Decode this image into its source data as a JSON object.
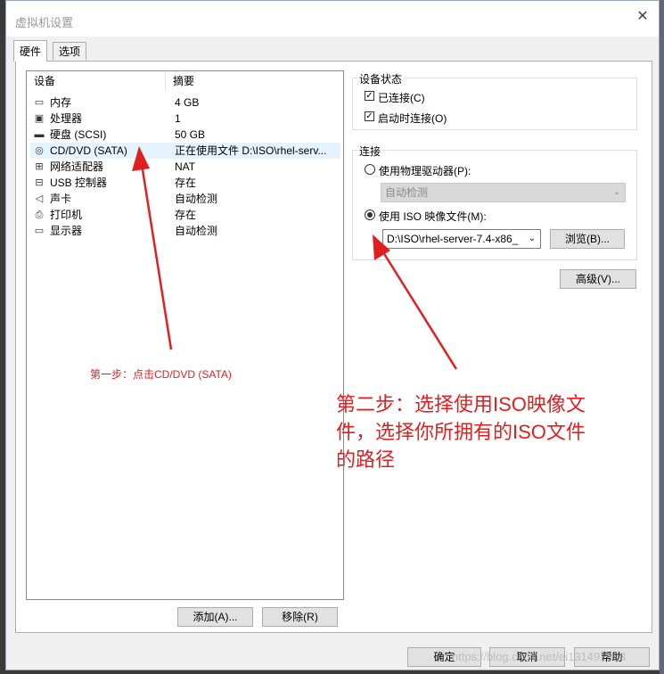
{
  "window": {
    "title": "虚拟机设置",
    "close_glyph": "✕"
  },
  "tabs": [
    {
      "label": "硬件",
      "active": true
    },
    {
      "label": "选项",
      "active": false
    }
  ],
  "device_list": {
    "headers": {
      "device": "设备",
      "summary": "摘要"
    },
    "rows": [
      {
        "icon": "memory-icon",
        "device": "内存",
        "summary": "4 GB"
      },
      {
        "icon": "processor-icon",
        "device": "处理器",
        "summary": "1"
      },
      {
        "icon": "harddisk-icon",
        "device": "硬盘 (SCSI)",
        "summary": "50 GB"
      },
      {
        "icon": "cd-dvd-icon",
        "device": "CD/DVD (SATA)",
        "summary": "正在使用文件 D:\\ISO\\rhel-serv...",
        "selected": true
      },
      {
        "icon": "network-adapter-icon",
        "device": "网络适配器",
        "summary": "NAT"
      },
      {
        "icon": "usb-icon",
        "device": "USB 控制器",
        "summary": "存在"
      },
      {
        "icon": "sound-card-icon",
        "device": "声卡",
        "summary": "自动检测"
      },
      {
        "icon": "printer-icon",
        "device": "打印机",
        "summary": "存在"
      },
      {
        "icon": "display-icon",
        "device": "显示器",
        "summary": "自动检测"
      }
    ]
  },
  "device_status": {
    "label": "设备状态",
    "connected": {
      "label": "已连接(C)",
      "checked": true
    },
    "connect_at_power_on": {
      "label": "启动时连接(O)",
      "checked": true
    }
  },
  "connection": {
    "label": "连接",
    "physical_drive": {
      "label": "使用物理驱动器(P):",
      "selected": false
    },
    "physical_drive_select": "自动检测",
    "iso_image": {
      "label": "使用 ISO 映像文件(M):",
      "selected": true
    },
    "iso_path": "D:\\ISO\\rhel-server-7.4-x86_",
    "browse_label": "浏览(B)..."
  },
  "advanced_label": "高级(V)...",
  "add_label": "添加(A)...",
  "remove_label": "移除(R)",
  "footer": {
    "ok_label": "确定",
    "cancel_label": "取消",
    "help_label": "帮助"
  },
  "annotations": {
    "step1": "第一步：点击CD/DVD (SATA)",
    "step2": "第二步：选择使用ISO映像文件，选择你所拥有的ISO文件的路径"
  },
  "watermark": "https://blog.csdn.net/ei131492323",
  "colors": {
    "annotation": "#e02020",
    "selection": "#e5f3ff"
  }
}
